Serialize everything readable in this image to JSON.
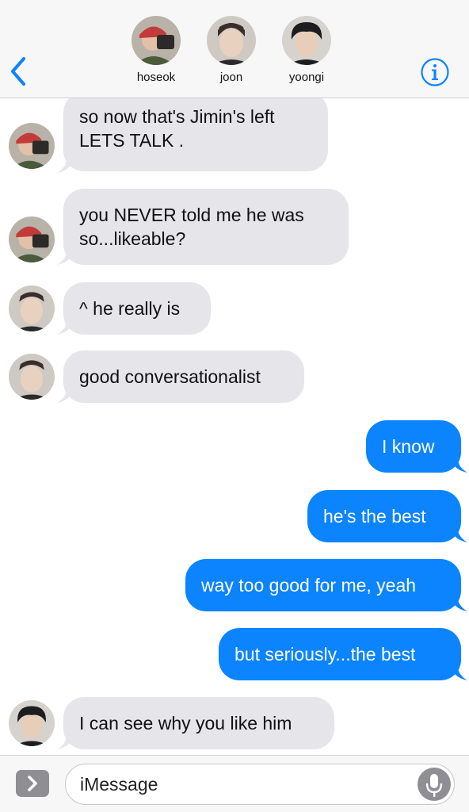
{
  "header": {
    "participants": [
      {
        "name": "hoseok",
        "avatar_colors": [
          "#c23b3b",
          "#2c2a28",
          "#e3c0a8"
        ]
      },
      {
        "name": "joon",
        "avatar_colors": [
          "#cfc9c4",
          "#3a2e2a",
          "#e9d1c0"
        ]
      },
      {
        "name": "yoongi",
        "avatar_colors": [
          "#d6d3cf",
          "#1d1d1f",
          "#e8cdb8"
        ]
      }
    ],
    "back_icon": "chevron-left-icon",
    "info_icon": "info-icon",
    "accent_color": "#0b84fe"
  },
  "messages": [
    {
      "from": "hoseok",
      "direction": "incoming",
      "lines": [
        "so now that's Jimin's left",
        "LETS TALK ."
      ]
    },
    {
      "from": "hoseok",
      "direction": "incoming",
      "lines": [
        "you NEVER told me he was",
        "so...likeable?"
      ]
    },
    {
      "from": "joon",
      "direction": "incoming",
      "lines": [
        "^ he really is"
      ]
    },
    {
      "from": "joon",
      "direction": "incoming",
      "lines": [
        "good conversationalist"
      ]
    },
    {
      "from": "me",
      "direction": "outgoing",
      "lines": [
        "I know"
      ]
    },
    {
      "from": "me",
      "direction": "outgoing",
      "lines": [
        "he's the best"
      ]
    },
    {
      "from": "me",
      "direction": "outgoing",
      "lines": [
        "way too good for me, yeah"
      ]
    },
    {
      "from": "me",
      "direction": "outgoing",
      "lines": [
        "but seriously...the best"
      ]
    },
    {
      "from": "yoongi",
      "direction": "incoming",
      "lines": [
        "I can see why you like him"
      ]
    }
  ],
  "composer": {
    "placeholder": "iMessage",
    "apps_icon": "chevron-right-icon",
    "mic_icon": "microphone-icon"
  },
  "colors": {
    "incoming_bubble": "#e5e5ea",
    "outgoing_bubble": "#0b84fe"
  }
}
